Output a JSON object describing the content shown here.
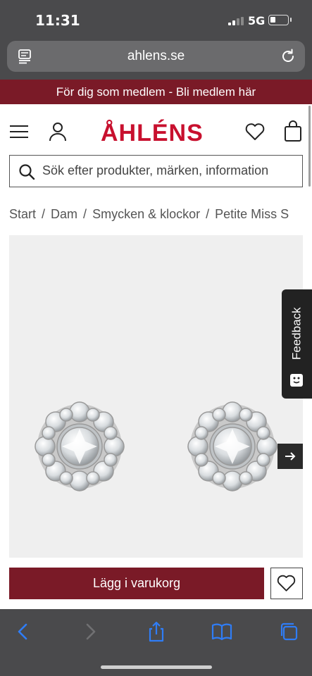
{
  "status_bar": {
    "time": "11:31",
    "network": "5G"
  },
  "browser": {
    "url": "ahlens.se"
  },
  "promo": {
    "text": "För dig som medlem - Bli medlem här"
  },
  "header": {
    "logo": "ÅHLÉNS"
  },
  "search": {
    "placeholder": "Sök efter produkter, märken, information"
  },
  "breadcrumb": {
    "items": [
      "Start",
      "Dam",
      "Smycken & klockor",
      "Petite Miss S"
    ],
    "separator": "/"
  },
  "feedback": {
    "label": "Feedback"
  },
  "product": {
    "add_to_cart_label": "Lägg i varukorg"
  },
  "colors": {
    "brand_red": "#c8102e",
    "promo_maroon": "#7a1a27",
    "browser_chrome": "#4a4a4c",
    "ios_blue": "#2f7df6"
  }
}
